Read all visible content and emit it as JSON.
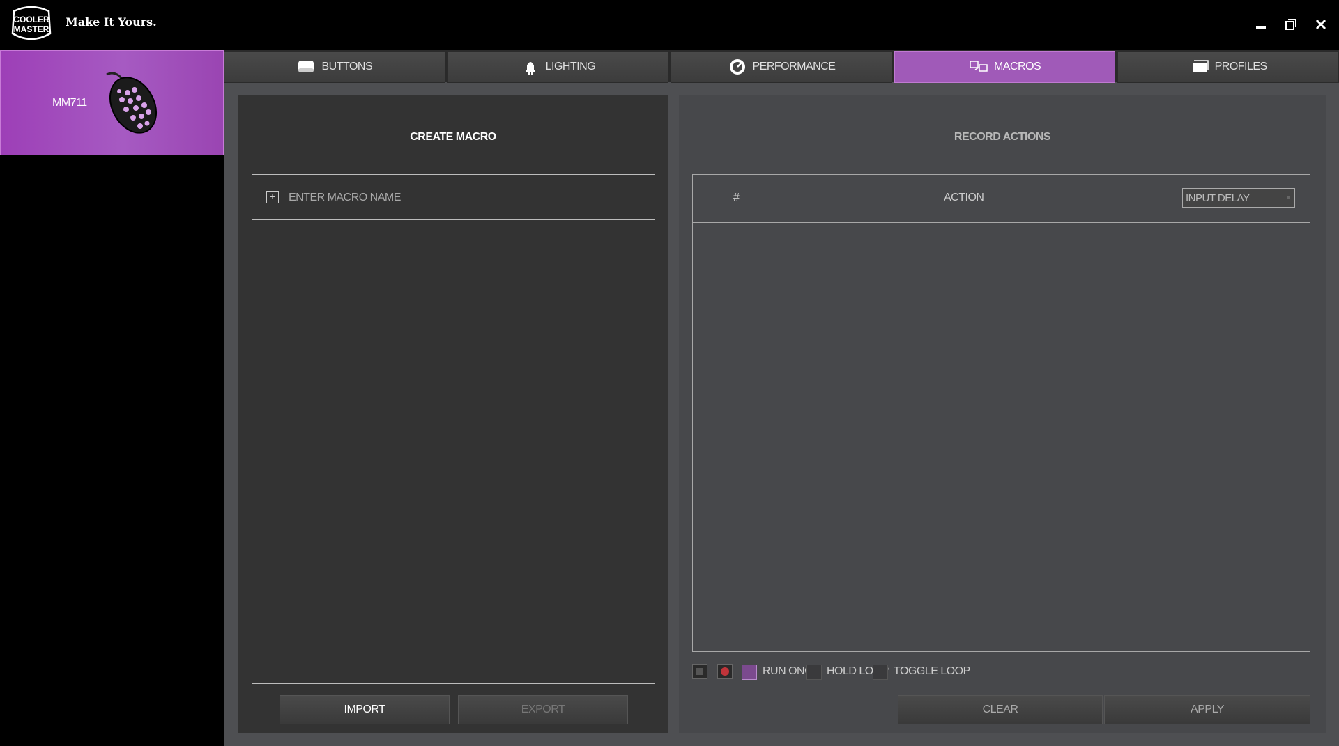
{
  "app": {
    "tagline": "Make It Yours.",
    "logo_text": [
      "COOLER",
      "MASTER"
    ]
  },
  "window_controls": {
    "minimize_icon": "minimize-icon",
    "maximize_icon": "restore-icon",
    "close_icon": "close-icon"
  },
  "device": {
    "name": "MM711",
    "image_icon": "mouse-icon"
  },
  "tabs": [
    {
      "label": "BUTTONS",
      "icon": "buttons-icon",
      "active": false
    },
    {
      "label": "LIGHTING",
      "icon": "lighting-icon",
      "active": false
    },
    {
      "label": "PERFORMANCE",
      "icon": "performance-icon",
      "active": false
    },
    {
      "label": "MACROS",
      "icon": "macros-icon",
      "active": true
    },
    {
      "label": "PROFILES",
      "icon": "profiles-icon",
      "active": false
    }
  ],
  "create_macro": {
    "title": "CREATE MACRO",
    "name_placeholder": "ENTER MACRO NAME",
    "name_value": "",
    "import_label": "IMPORT",
    "export_label": "EXPORT"
  },
  "record_actions": {
    "title": "RECORD ACTIONS",
    "col_number": "#",
    "col_action": "ACTION",
    "delay_select": "INPUT DELAY",
    "run_once_label": "RUN ONCE",
    "hold_loop_label": "HOLD LOOP",
    "toggle_loop_label": "TOGGLE LOOP",
    "clear_label": "CLEAR",
    "apply_label": "APPLY",
    "run_mode": "RUN ONCE"
  },
  "colors": {
    "accent": "#a05ab8",
    "background": "#000000",
    "panel": "#333333"
  }
}
